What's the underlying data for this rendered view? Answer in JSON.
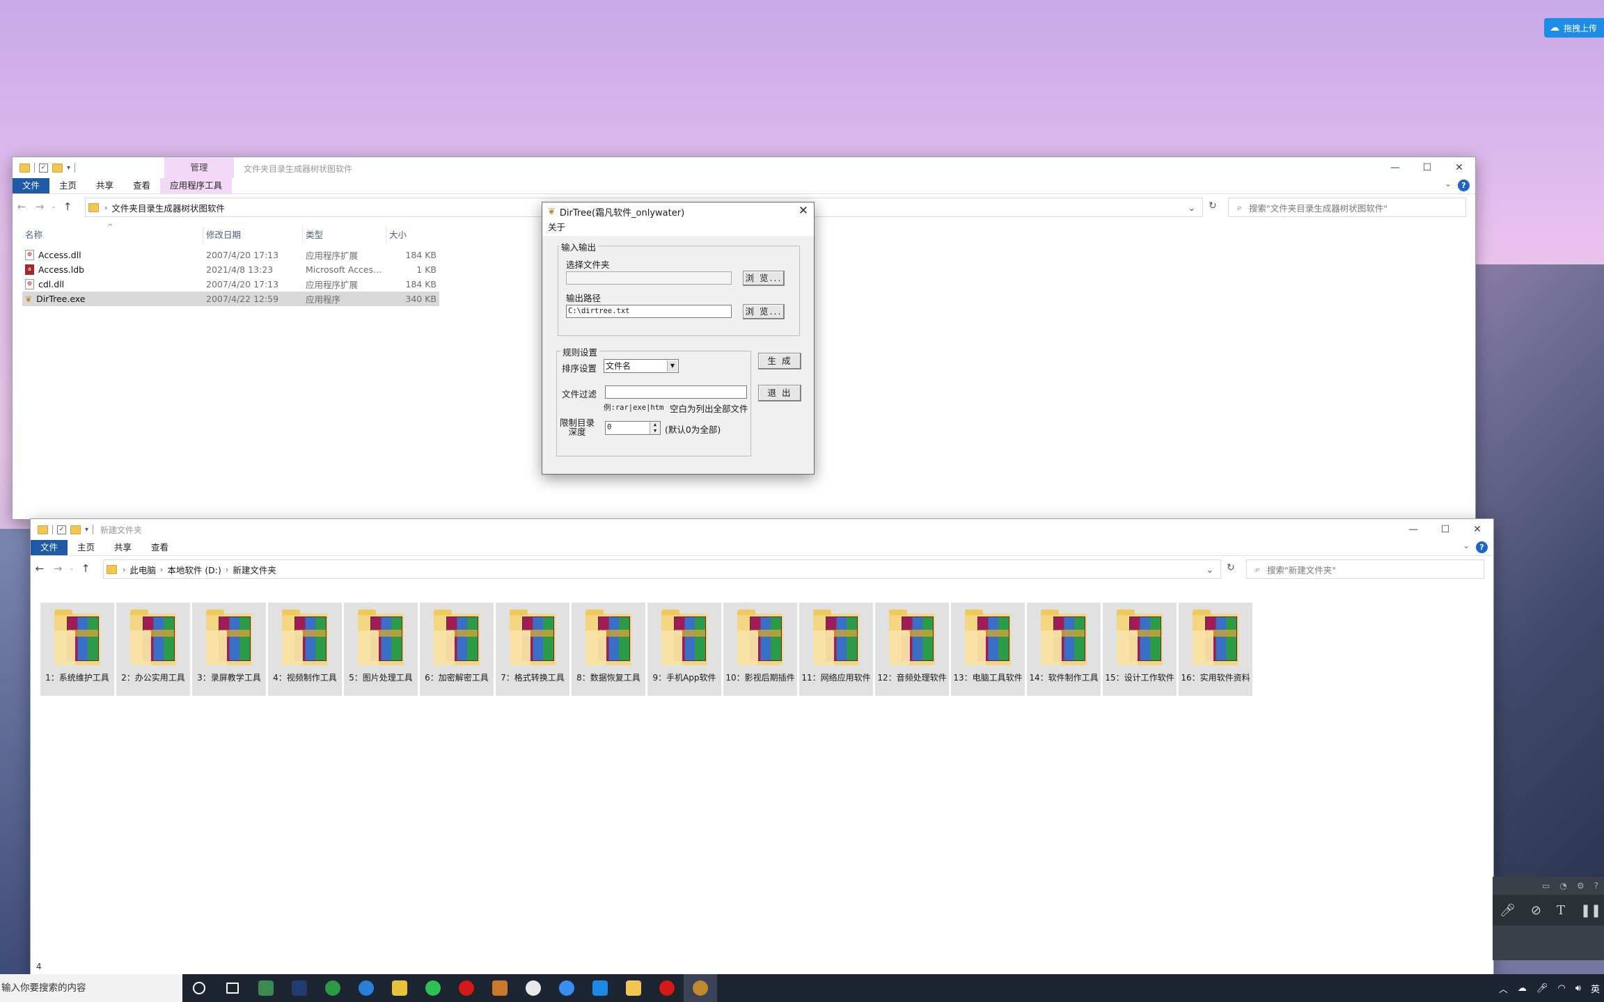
{
  "desktop": {
    "baidu_widget": "拖拽上传"
  },
  "explorer1": {
    "title": "文件夹目录生成器树状图软件",
    "context_tab": "管理",
    "context_subtab": "应用程序工具",
    "ribbon_tabs": [
      "文件",
      "主页",
      "共享",
      "查看"
    ],
    "breadcrumb": [
      "文件夹目录生成器树状图软件"
    ],
    "search_placeholder": "搜索\"文件夹目录生成器树状图软件\"",
    "columns": [
      "名称",
      "修改日期",
      "类型",
      "大小"
    ],
    "files": [
      {
        "name": "Access.dll",
        "date": "2007/4/20 17:13",
        "type": "应用程序扩展",
        "size": "184 KB"
      },
      {
        "name": "Access.ldb",
        "date": "2021/4/8 13:23",
        "type": "Microsoft Acces...",
        "size": "1 KB"
      },
      {
        "name": "cdl.dll",
        "date": "2007/4/20 17:13",
        "type": "应用程序扩展",
        "size": "184 KB"
      },
      {
        "name": "DirTree.exe",
        "date": "2007/4/22 12:59",
        "type": "应用程序",
        "size": "340 KB"
      }
    ]
  },
  "dialog": {
    "title": "DirTree(霜凡软件_onlywater)",
    "menu_about": "关于",
    "group_io": "输入输出",
    "select_folder_label": "选择文件夹",
    "select_folder_value": "",
    "browse1": "浏 览...",
    "output_path_label": "输出路径",
    "output_path_value": "C:\\dirtree.txt",
    "browse2": "浏 览...",
    "group_rules": "规则设置",
    "sort_label": "排序设置",
    "sort_value": "文件名",
    "filter_label": "文件过滤",
    "filter_value": "",
    "filter_hint_example": "例:rar|exe|htm",
    "filter_hint_empty": "空白为列出全部文件",
    "depth_label": "限制目录深度",
    "depth_value": "0",
    "depth_hint": "(默认0为全部)",
    "generate_button": "生 成",
    "exit_button": "退 出"
  },
  "explorer2": {
    "title": "新建文件夹",
    "ribbon_tabs": [
      "文件",
      "主页",
      "共享",
      "查看"
    ],
    "breadcrumb": [
      "此电脑",
      "本地软件 (D:)",
      "新建文件夹"
    ],
    "search_placeholder": "搜索\"新建文件夹\"",
    "folders": [
      "1：系统维护工具",
      "2：办公实用工具",
      "3：录屏教学工具",
      "4：视频制作工具",
      "5：图片处理工具",
      "6：加密解密工具",
      "7：格式转换工具",
      "8：数据恢复工具",
      "9：手机App软件",
      "10：影视后期插件",
      "11：网络应用软件",
      "12：音频处理软件",
      "13：电脑工具软件",
      "14：软件制作工具",
      "15：设计工作软件",
      "16：实用软件资料"
    ],
    "status_count": "4"
  },
  "taskbar": {
    "search_placeholder": "输入你要搜索的内容",
    "tray_lang": "英"
  },
  "colors": {
    "file_tab": "#1f5aa6",
    "context_tab": "#f3d9f7",
    "taskbar": "#1e2532"
  }
}
